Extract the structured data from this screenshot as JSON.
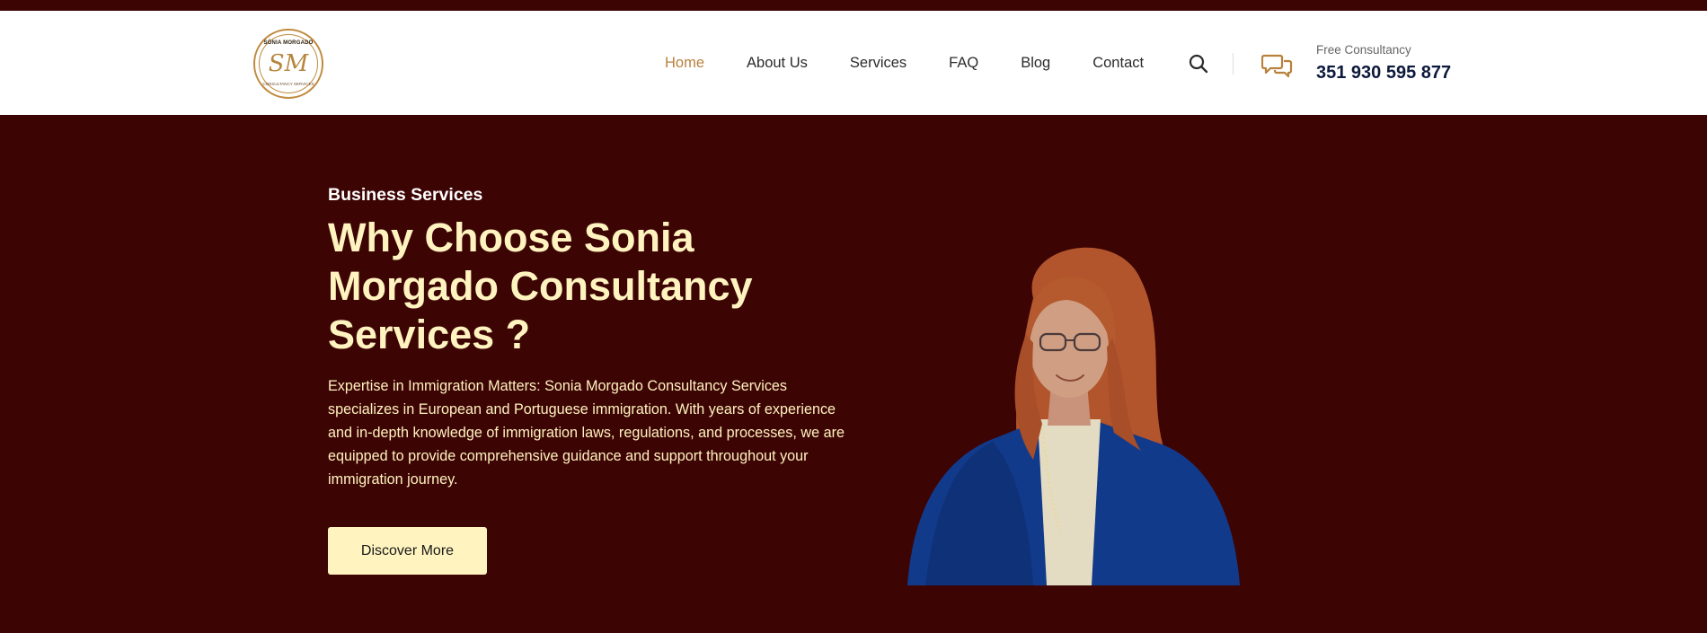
{
  "brand": {
    "logo_top_text": "SÓNIA MORGADO",
    "logo_monogram": "SM",
    "logo_bottom_text": "CONSULTANCY SERVICES"
  },
  "nav": {
    "items": [
      {
        "label": "Home",
        "active": true
      },
      {
        "label": "About Us",
        "active": false
      },
      {
        "label": "Services",
        "active": false
      },
      {
        "label": "FAQ",
        "active": false
      },
      {
        "label": "Blog",
        "active": false
      },
      {
        "label": "Contact",
        "active": false
      }
    ]
  },
  "header": {
    "search_icon": "search-icon",
    "chat_icon": "chat-icon",
    "consultancy_label": "Free Consultancy",
    "phone": "351 930 595 877"
  },
  "hero": {
    "kicker": "Business Services",
    "headline": "Why Choose Sonia Morgado Consultancy Services ?",
    "body": "Expertise in Immigration Matters: Sonia Morgado Consultancy Services specializes in European and Portuguese immigration. With years of experience and in-depth knowledge of immigration laws, regulations, and processes, we are equipped to provide comprehensive guidance and support throughout your immigration journey.",
    "cta_label": "Discover More"
  },
  "colors": {
    "background": "#3d0404",
    "accent": "#b8813c",
    "cream": "#fff3bf",
    "phone": "#0e1a3d"
  }
}
